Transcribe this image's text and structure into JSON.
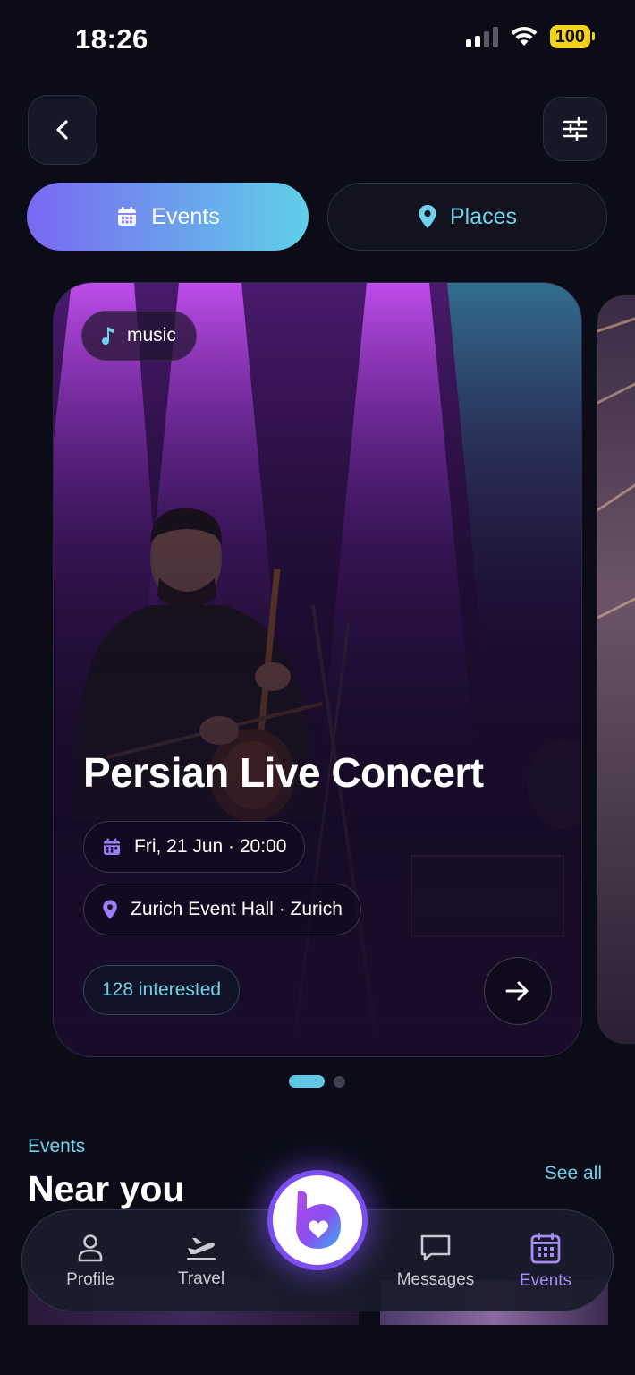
{
  "status_bar": {
    "time": "18:26",
    "battery": "100"
  },
  "tabs": [
    {
      "label": "Events",
      "icon": "calendar-icon",
      "active": true
    },
    {
      "label": "Places",
      "icon": "map-pin-icon",
      "active": false
    }
  ],
  "featured_event": {
    "category": "music",
    "title": "Persian Live Concert",
    "datetime": "Fri, 21 Jun · 20:00",
    "location": "Zurich Event Hall · Zurich",
    "interested": "128 interested"
  },
  "pager": {
    "current": 1,
    "total": 2
  },
  "section": {
    "eyebrow": "Events",
    "title": "Near you",
    "see_all": "See all"
  },
  "bottom_nav": {
    "items": [
      {
        "label": "Profile",
        "icon": "person-icon",
        "active": false
      },
      {
        "label": "Travel",
        "icon": "plane-icon",
        "active": false
      },
      {
        "label": "Messages",
        "icon": "chat-icon",
        "active": false
      },
      {
        "label": "Events",
        "icon": "calendar-icon",
        "active": true
      }
    ],
    "center_icon": "app-logo-icon"
  },
  "colors": {
    "accent_cyan": "#6fd2ea",
    "accent_purple": "#a58cf6",
    "background": "#0b0c18"
  }
}
